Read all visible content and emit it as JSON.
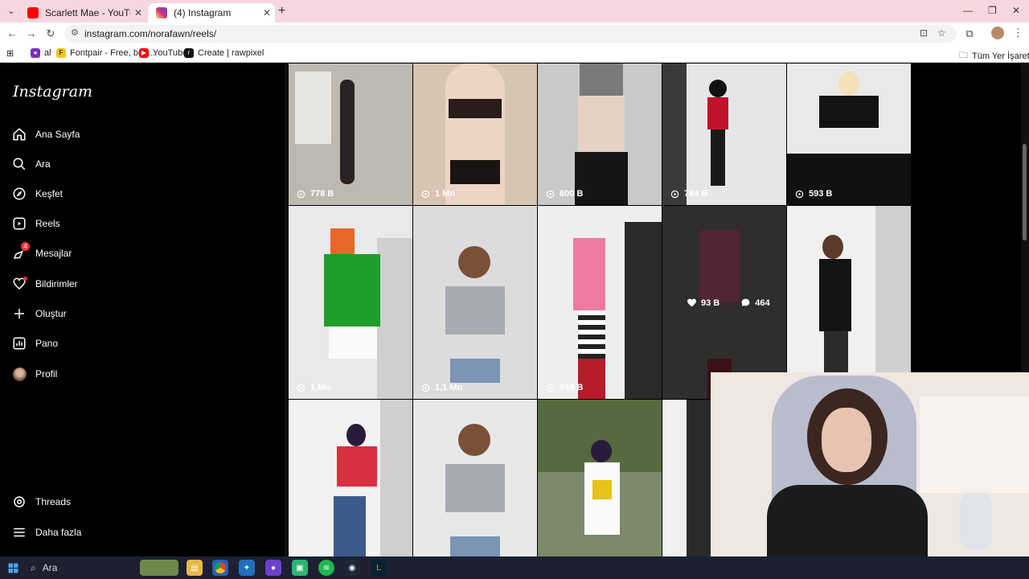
{
  "browser": {
    "tabs": [
      {
        "title": "Scarlett Mae - YouTube",
        "favicon_color": "#ff0000"
      },
      {
        "title": "(4) Instagram",
        "favicon_color": "#d62976"
      }
    ],
    "url": "instagram.com/norafawn/reels/",
    "bookmarks": [
      {
        "label": "al",
        "color": "#7b2fbe",
        "glyph": "●"
      },
      {
        "label": "Fontpair - Free, bea...",
        "color": "#f5c518",
        "glyph": "F"
      },
      {
        "label": "YouTube",
        "color": "#ff0000",
        "glyph": "▶"
      },
      {
        "label": "Create | rawpixel",
        "color": "#111111",
        "glyph": "r"
      }
    ],
    "bookmarks_folder": "Tüm Yer İşaretleri"
  },
  "instagram": {
    "logo": "Instagram",
    "nav": [
      {
        "label": "Ana Sayfa",
        "icon": "home-icon"
      },
      {
        "label": "Ara",
        "icon": "search-icon"
      },
      {
        "label": "Keşfet",
        "icon": "compass-icon"
      },
      {
        "label": "Reels",
        "icon": "reels-icon"
      },
      {
        "label": "Mesajlar",
        "icon": "messenger-icon",
        "badge": "4"
      },
      {
        "label": "Bildirimler",
        "icon": "heart-icon"
      },
      {
        "label": "Oluştur",
        "icon": "plus-icon"
      },
      {
        "label": "Pano",
        "icon": "dashboard-icon"
      },
      {
        "label": "Profil",
        "icon": "avatar-icon"
      }
    ],
    "nav_bottom": [
      {
        "label": "Threads",
        "icon": "threads-icon"
      },
      {
        "label": "Daha fazla",
        "icon": "menu-icon"
      }
    ],
    "reels": [
      {
        "views": "778 B",
        "bg": "#bdb9b2"
      },
      {
        "views": "1 Mn",
        "bg": "#d8c4b2"
      },
      {
        "views": "600 B",
        "bg": "#c9c9c9"
      },
      {
        "views": "764 B",
        "bg": "#e6e6e6"
      },
      {
        "views": "593 B",
        "bg": "#111111"
      },
      {
        "views": "1 Mn",
        "bg": "#e9e9e9"
      },
      {
        "views": "1,1 Mn",
        "bg": "#dcdcdc"
      },
      {
        "views": "949 B",
        "bg": "#eeeeee"
      },
      {
        "likes": "93 B",
        "comments": "464",
        "bg": "#4a4646"
      },
      {
        "views": "",
        "bg": "#f0f0f0"
      },
      {
        "views": "",
        "bg": "#f2f2f2"
      },
      {
        "views": "",
        "bg": "#e8e8e8"
      },
      {
        "views": "",
        "bg": "#7a8a6a"
      },
      {
        "views": "",
        "bg": "#f0f0f0"
      }
    ]
  },
  "taskbar": {
    "search_label": "Ara"
  }
}
